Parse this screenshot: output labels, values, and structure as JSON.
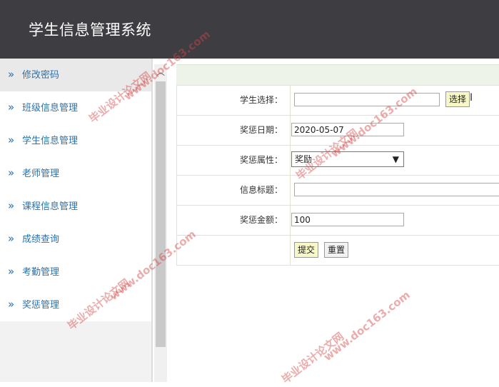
{
  "header": {
    "title": "学生信息管理系统"
  },
  "sidebar": {
    "items": [
      {
        "label": "修改密码"
      },
      {
        "label": "班级信息管理"
      },
      {
        "label": "学生信息管理"
      },
      {
        "label": "老师管理"
      },
      {
        "label": "课程信息管理"
      },
      {
        "label": "成绩查询"
      },
      {
        "label": "考勤管理"
      },
      {
        "label": "奖惩管理"
      }
    ]
  },
  "form": {
    "student_label": "学生选择：",
    "student_value": "",
    "select_button": "选择",
    "date_label": "奖惩日期：",
    "date_value": "2020-05-07",
    "type_label": "奖惩属性：",
    "type_value": "奖励",
    "title_label": "信息标题：",
    "title_value": "",
    "amount_label": "奖惩金额：",
    "amount_value": "100",
    "submit_button": "提交",
    "reset_button": "重置"
  },
  "watermark": {
    "text1": "毕业设计论文网",
    "text2": "www.doc163.com"
  }
}
